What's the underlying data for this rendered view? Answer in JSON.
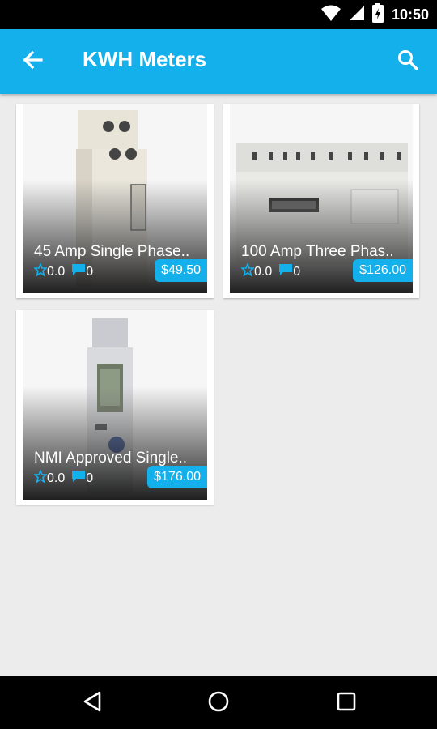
{
  "status_bar": {
    "time": "10:50"
  },
  "app_bar": {
    "title": "KWH Meters"
  },
  "products": [
    {
      "title": "45 Amp Single Phase..",
      "rating": "0.0",
      "comments": "0",
      "price": "$49.50"
    },
    {
      "title": "100 Amp Three Phas..",
      "rating": "0.0",
      "comments": "0",
      "price": "$126.00"
    },
    {
      "title": "NMI Approved Single..",
      "rating": "0.0",
      "comments": "0",
      "price": "$176.00"
    }
  ],
  "colors": {
    "accent": "#13b0ec",
    "background": "#ececec"
  }
}
